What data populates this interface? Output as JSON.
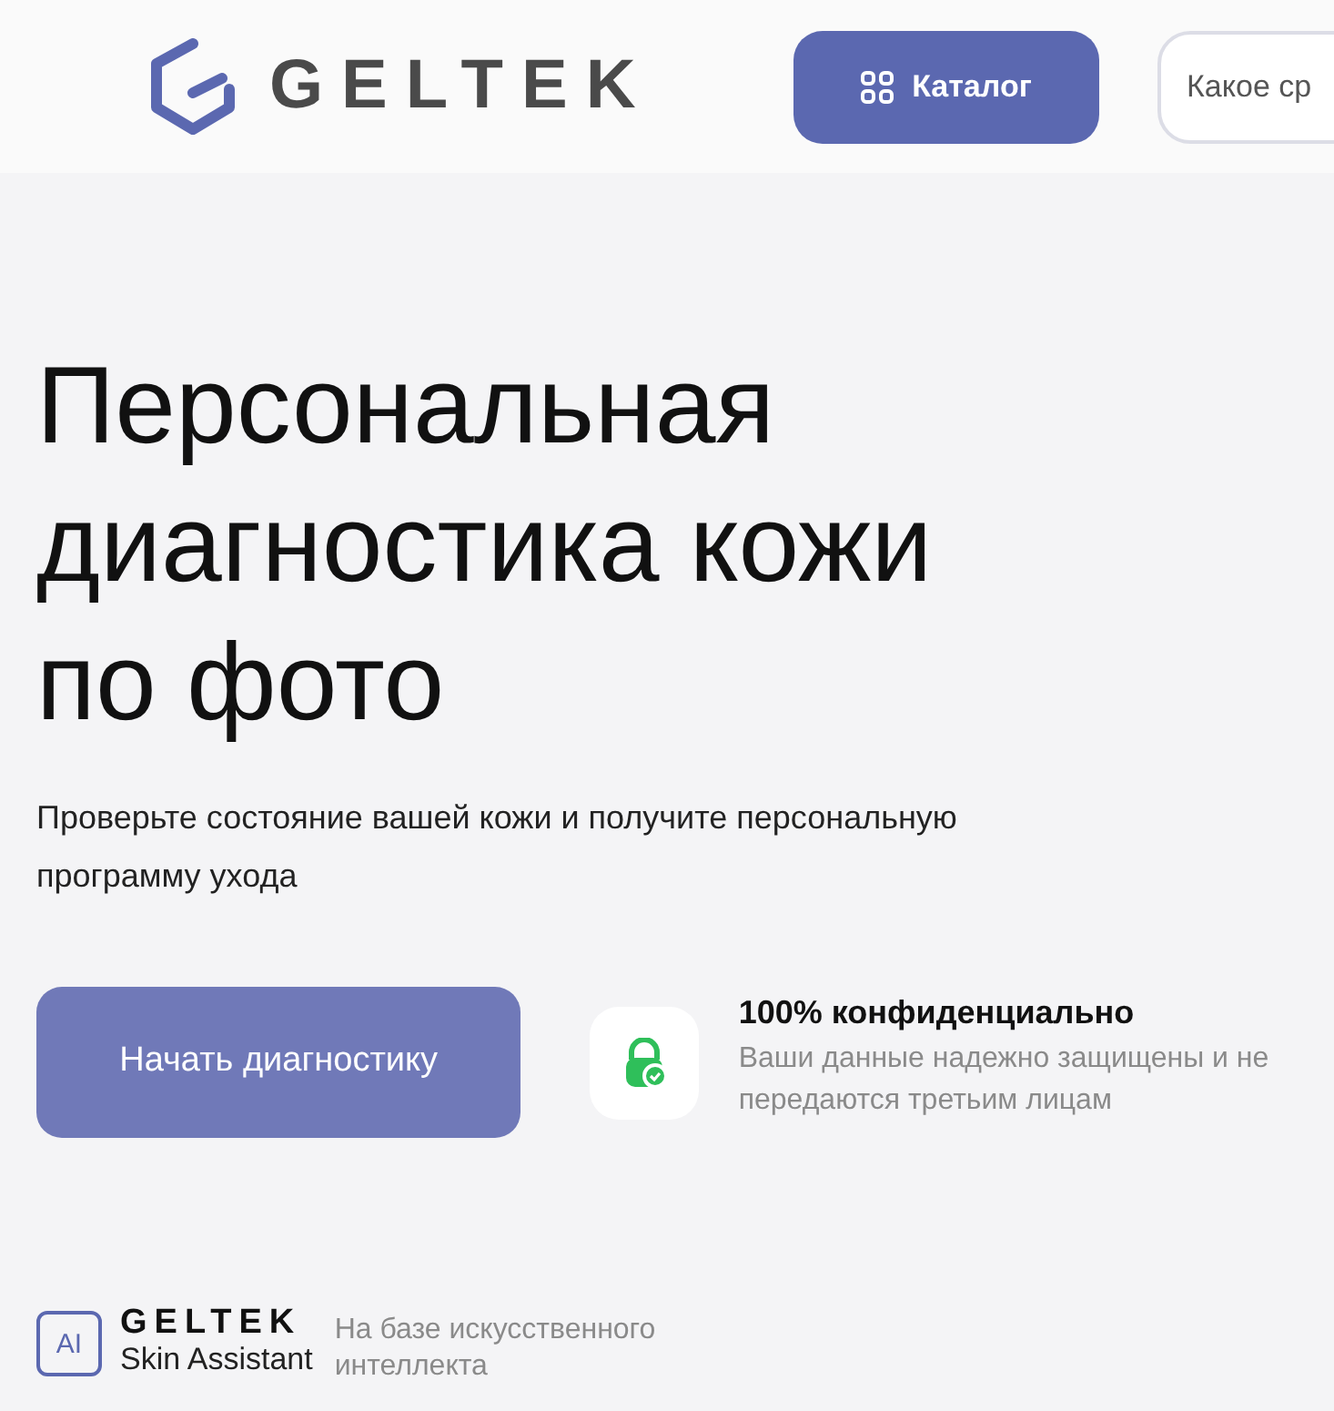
{
  "header": {
    "logo": "GELTEK",
    "catalog_button": "Каталог",
    "search": {
      "placeholder": "Какое ср"
    }
  },
  "hero": {
    "title": "Персональная диагностика кожи по фото",
    "subtitle": "Проверьте состояние вашей кожи и получите персональную программу ухода",
    "start_button": "Начать диагностику",
    "privacy": {
      "title": "100% конфиденциально",
      "text": "Ваши данные надежно защищены и не передаются третьим лицам"
    }
  },
  "footer_badge": {
    "icon_text": "AI",
    "brand": "GELTEK",
    "product": "Skin Assistant",
    "note": "На базе искусственного интеллекта"
  }
}
